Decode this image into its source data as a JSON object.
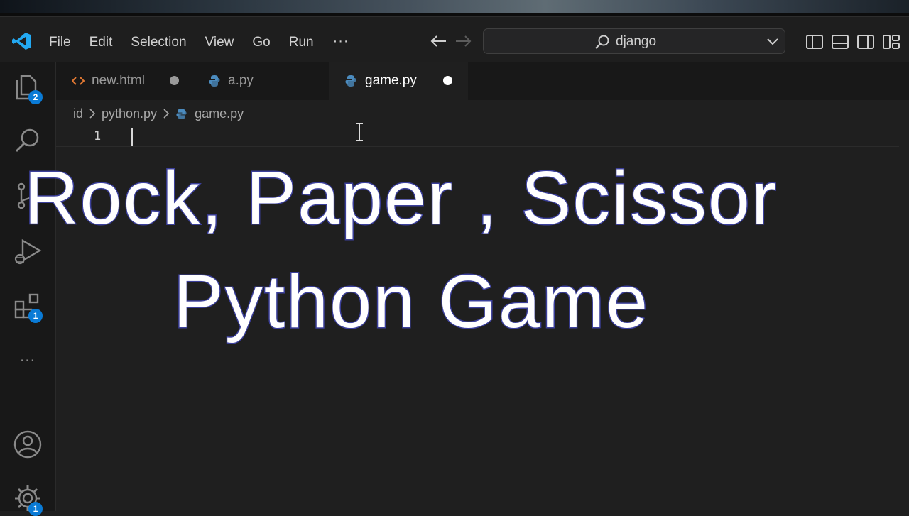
{
  "menu": {
    "items": [
      "File",
      "Edit",
      "Selection",
      "View",
      "Go",
      "Run"
    ],
    "more": "···"
  },
  "command_center": {
    "text": "django"
  },
  "activity_bar": {
    "explorer_badge": "2",
    "extensions_badge": "1",
    "more": "···",
    "manage_badge": "1"
  },
  "tabs": [
    {
      "label": "new.html",
      "icon": "html-icon",
      "dirty": true,
      "active": false
    },
    {
      "label": "a.py",
      "icon": "python-icon",
      "dirty": false,
      "active": false
    },
    {
      "label": "game.py",
      "icon": "python-icon",
      "dirty": true,
      "active": true
    }
  ],
  "breadcrumb": {
    "items": [
      "id",
      "python.py",
      "game.py"
    ]
  },
  "editor": {
    "line_number": "1"
  },
  "overlay": {
    "line1": "Rock, Paper , Scissor",
    "line2": "Python Game"
  },
  "colors": {
    "accent": "#0a7bd6",
    "overlay_stroke": "#3b3f9a",
    "html_icon": "#e37933",
    "python_icon": "#4b8bbe"
  }
}
